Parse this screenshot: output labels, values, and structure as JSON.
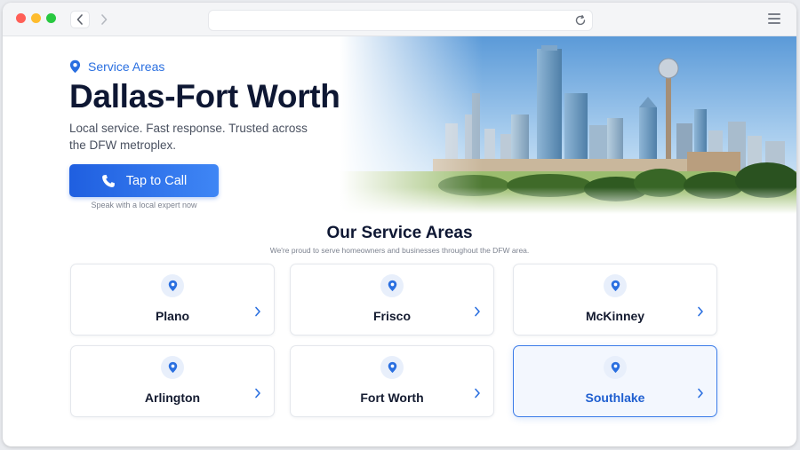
{
  "browser": {
    "url": "",
    "icons": [
      "back-icon",
      "forward-icon",
      "reload-icon",
      "hamburger-menu-icon"
    ]
  },
  "hero": {
    "eyebrow": "Service Areas",
    "title": "Dallas-Fort Worth",
    "subtitle": "Local service.  Fast response.  Trusted across the DFW metroplex.",
    "cta_label": "Tap to Call",
    "cta_note": "Speak with a local expert now"
  },
  "areas": {
    "title": "Our Service Areas",
    "subtitle": "We're proud to serve homeowners and businesses throughout the DFW area.",
    "cards": [
      {
        "label": "Plano",
        "selected": false
      },
      {
        "label": "Frisco",
        "selected": false
      },
      {
        "label": "McKinney",
        "selected": false
      },
      {
        "label": "Arlington",
        "selected": false
      },
      {
        "label": "Fort Worth",
        "selected": false
      },
      {
        "label": "Southlake",
        "selected": true
      }
    ]
  },
  "colors": {
    "accent": "#2a6fe0",
    "heading": "#0e1733",
    "selected_border": "#3a7be8"
  }
}
